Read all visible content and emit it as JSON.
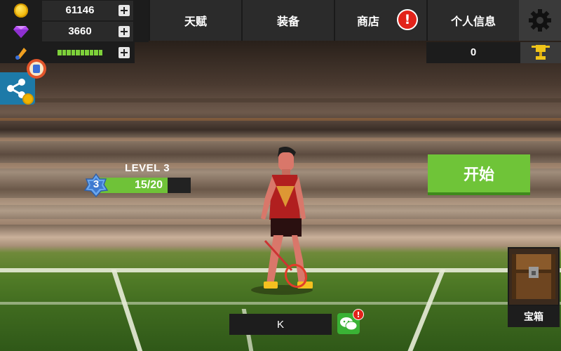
{
  "resources": {
    "coins": "61146",
    "gems": "3660",
    "coin_icon": "coin-icon",
    "gem_icon": "gem-icon",
    "energy_icon": "shuttlecock-icon",
    "energy_level": 1.0
  },
  "tabs": [
    {
      "label": "天赋"
    },
    {
      "label": "装备"
    },
    {
      "label": "商店",
      "alert": "!"
    },
    {
      "label": "个人信息"
    }
  ],
  "settings_icon": "gear-icon",
  "trophy": {
    "value": "0",
    "icon": "trophy-icon"
  },
  "share_icon": "share-icon",
  "level": {
    "title": "LEVEL 3",
    "number": "3",
    "xp_text": "15/20",
    "progress": 0.75
  },
  "start_button": {
    "label": "开始"
  },
  "chest": {
    "label": "宝箱",
    "icon": "treasure-chest-icon"
  },
  "player_name": "K",
  "wechat": {
    "icon": "wechat-icon",
    "alert": "!"
  },
  "colors": {
    "accent_green": "#6fc438",
    "alert_red": "#e2231a",
    "panel_dark": "#1c1c1c",
    "tab_bg": "#2b2b2b"
  }
}
